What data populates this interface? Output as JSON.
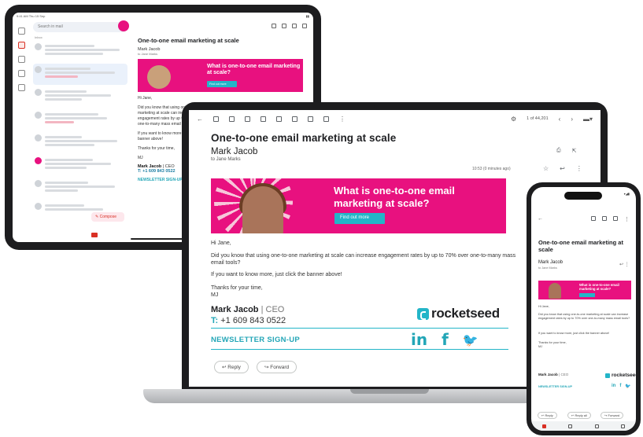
{
  "email": {
    "subject": "One-to-one email marketing at scale",
    "from": "Mark Jacob",
    "to": "to Jane Marks",
    "time": "10:53 (0 minutes ago)",
    "greeting": "Hi Jane,",
    "body1": "Did you know that using one-to-one marketing at scale can increase engagement rates by up to 70% over one-to-many mass email tools?",
    "body2": "If you want to know more, just click the banner above!",
    "closing": "Thanks for your time,",
    "initials": "MJ",
    "count": "1 of 44,201"
  },
  "banner": {
    "title": "What is one-to-one email marketing at scale?",
    "cta": "Find out more"
  },
  "signature": {
    "name": "Mark Jacob",
    "role": "CEO",
    "phone_prefix": "T:",
    "phone": "+1 609 843 0522",
    "newsletter": "NEWSLETTER SIGN-UP",
    "brand": "rocketseed",
    "social": [
      "in",
      "f",
      "🐦"
    ]
  },
  "actions": {
    "reply": "Reply",
    "forward": "Forward",
    "reply_all": "Reply all"
  },
  "tablet": {
    "status_time": "9:41 AM  Thu 15 Sep",
    "search_placeholder": "Search in mail",
    "inbox_label": "Inbox",
    "compose": "Compose"
  },
  "phone": {
    "status": "9:41"
  },
  "colors": {
    "brand_pink": "#e8117f",
    "brand_teal": "#23b5c8"
  }
}
